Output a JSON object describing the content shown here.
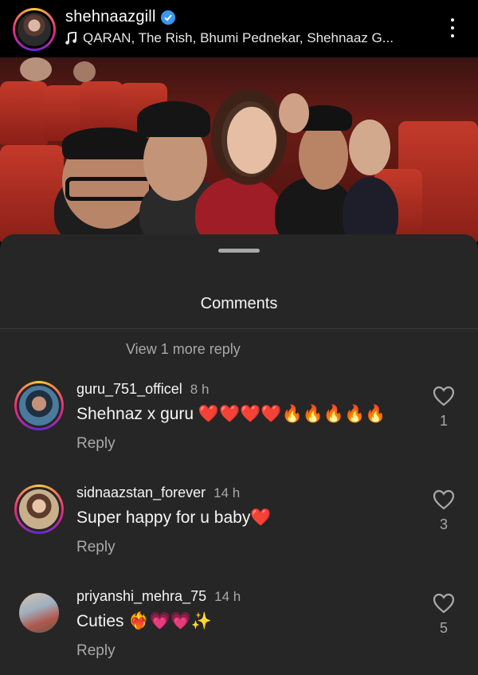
{
  "post": {
    "username": "shehnaazgill",
    "audio": "QARAN, The Rish, Bhumi Pednekar, Shehnaaz G..."
  },
  "sheet": {
    "title": "Comments",
    "view_more": "View 1 more reply"
  },
  "comments": [
    {
      "username": "guru_751_officel",
      "time": "8 h",
      "text": "Shehnaz x guru ❤️❤️❤️❤️🔥🔥🔥🔥🔥",
      "reply": "Reply",
      "likes": "1"
    },
    {
      "username": "sidnaazstan_forever",
      "time": "14 h",
      "text": "Super happy for u baby❤️",
      "reply": "Reply",
      "likes": "3"
    },
    {
      "username": "priyanshi_mehra_75",
      "time": "14 h",
      "text": "Cuties ❤️‍🔥💗💗✨",
      "reply": "Reply",
      "likes": "5"
    }
  ],
  "icons": {
    "verified": "verified-badge-icon",
    "music": "music-note-icon",
    "more": "more-vertical-icon",
    "like": "heart-outline-icon"
  },
  "colors": {
    "sheet_bg": "#262626",
    "verified_blue": "#3897f0",
    "muted_text": "#a8a8a8"
  }
}
